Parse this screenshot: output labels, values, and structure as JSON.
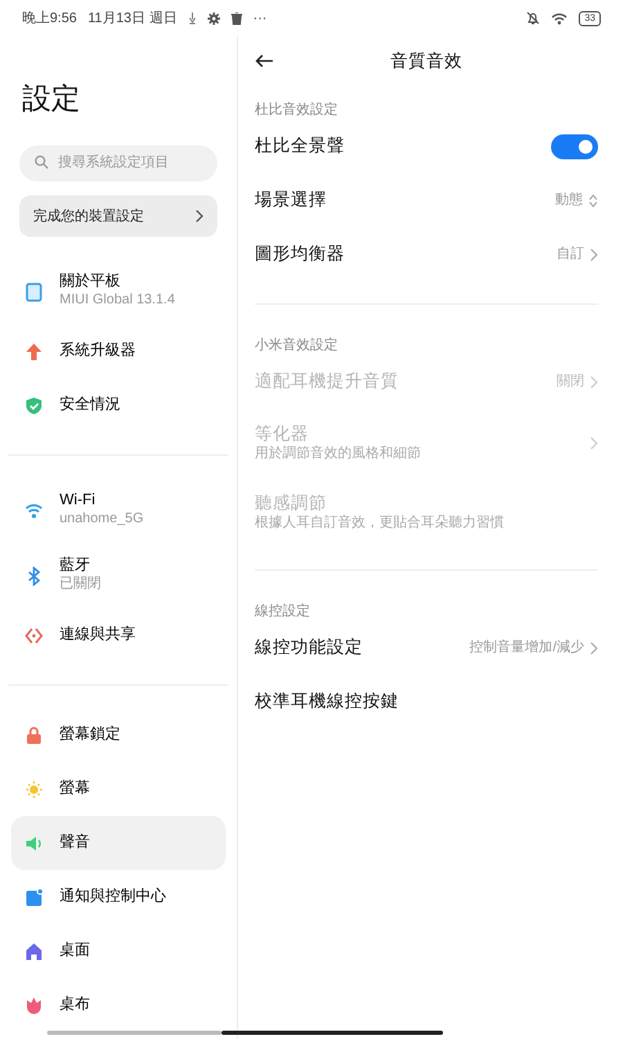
{
  "status_bar": {
    "time": "晚上9:56",
    "date": "11月13日 週日",
    "more": "···",
    "battery": "33"
  },
  "sidebar": {
    "title": "設定",
    "search": {
      "placeholder": "搜尋系統設定項目"
    },
    "setup_card": {
      "label": "完成您的裝置設定"
    },
    "groups": [
      [
        {
          "label": "關於平板",
          "subtitle": "MIUI Global 13.1.4",
          "selected": false
        },
        {
          "label": "系統升級器",
          "selected": false
        },
        {
          "label": "安全情況",
          "selected": false
        }
      ],
      [
        {
          "label": "Wi-Fi",
          "subtitle": "unahome_5G",
          "selected": false
        },
        {
          "label": "藍牙",
          "subtitle": "已關閉",
          "selected": false
        },
        {
          "label": "連線與共享",
          "selected": false
        }
      ],
      [
        {
          "label": "螢幕鎖定",
          "selected": false
        },
        {
          "label": "螢幕",
          "selected": false
        },
        {
          "label": "聲音",
          "selected": true
        },
        {
          "label": "通知與控制中心",
          "selected": false
        },
        {
          "label": "桌面",
          "selected": false
        },
        {
          "label": "桌布",
          "selected": false
        }
      ]
    ]
  },
  "main": {
    "title": "音質音效",
    "sections": [
      {
        "header": "杜比音效設定",
        "rows": [
          {
            "kind": "toggle",
            "label": "杜比全景聲",
            "on": true,
            "disabled": false
          },
          {
            "kind": "select",
            "label": "場景選擇",
            "value": "動態",
            "disabled": false
          },
          {
            "kind": "link",
            "label": "圖形均衡器",
            "value": "自訂",
            "disabled": false
          }
        ]
      },
      {
        "header": "小米音效設定",
        "rows": [
          {
            "kind": "link",
            "label": "適配耳機提升音質",
            "value": "關閉",
            "disabled": true
          },
          {
            "kind": "link",
            "label": "等化器",
            "subtitle": "用於調節音效的風格和細節",
            "disabled": true
          },
          {
            "kind": "plain",
            "label": "聽感調節",
            "subtitle": "根據人耳自訂音效，更貼合耳朵聽力習慣",
            "disabled": true
          }
        ]
      },
      {
        "header": "線控設定",
        "rows": [
          {
            "kind": "link",
            "label": "線控功能設定",
            "value": "控制音量增加/減少",
            "disabled": false
          },
          {
            "kind": "plain",
            "label": "校準耳機線控按鍵",
            "disabled": false
          }
        ]
      }
    ]
  }
}
